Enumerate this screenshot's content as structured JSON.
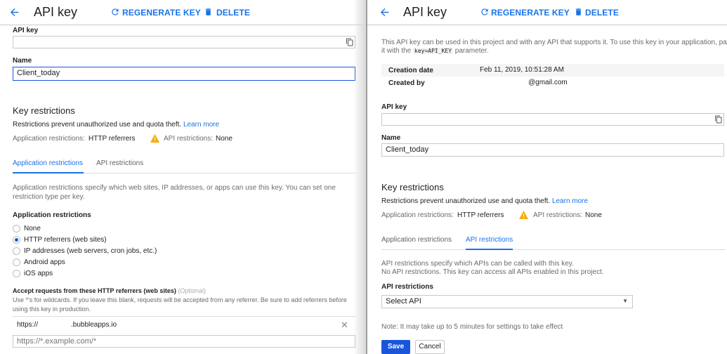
{
  "left": {
    "header": {
      "title": "API key",
      "regenerate": "REGENERATE KEY",
      "delete": "DELETE"
    },
    "api_key_label": "API key",
    "api_key_value": "",
    "name_label": "Name",
    "name_value": "Client_today",
    "key_restrictions": {
      "heading": "Key restrictions",
      "description": "Restrictions prevent unauthorized use and quota theft.",
      "learn_more": "Learn more",
      "app_label": "Application restrictions:",
      "app_value": "HTTP referrers",
      "api_label": "API restrictions:",
      "api_value": "None"
    },
    "tabs": [
      "Application restrictions",
      "API restrictions"
    ],
    "active_tab": 0,
    "app_desc_1": "Application restrictions specify which web sites, IP addresses, or apps can use this key. You can set one",
    "app_desc_2": "restriction type per key.",
    "app_restrictions_heading": "Application restrictions",
    "radio_options": [
      "None",
      "HTTP referrers (web sites)",
      "IP addresses (web servers, cron jobs, etc.)",
      "Android apps",
      "iOS apps"
    ],
    "selected_radio": 1,
    "accept_heading": "Accept requests from these HTTP referrers (web sites)",
    "optional": "(Optional)",
    "wildcard_1": "Use *'s for wildcards. If you leave this blank, requests will be accepted from any referrer. Be sure to add referrers before",
    "wildcard_2": "using this key in production.",
    "referrer_prefix": "https://",
    "referrer_suffix": ".bubbleapps.io",
    "referrer_placeholder": "https://*.example.com/*"
  },
  "right": {
    "header": {
      "title": "API key",
      "regenerate": "REGENERATE KEY",
      "delete": "DELETE"
    },
    "intro_1": "This API key can be used in this project and with any API that supports it. To use this key in your application, pass",
    "intro_2a": "it with the",
    "intro_code": "key=API_KEY",
    "intro_2b": "parameter.",
    "creation_label": "Creation date",
    "creation_value": "Feb 11, 2019, 10:51:28 AM",
    "created_by_label": "Created by",
    "created_by_value": "@gmail.com",
    "api_key_label": "API key",
    "api_key_value": "",
    "name_label": "Name",
    "name_value": "Client_today",
    "key_restrictions": {
      "heading": "Key restrictions",
      "description": "Restrictions prevent unauthorized use and quota theft.",
      "learn_more": "Learn more",
      "app_label": "Application restrictions:",
      "app_value": "HTTP referrers",
      "api_label": "API restrictions:",
      "api_value": "None"
    },
    "tabs": [
      "Application restrictions",
      "API restrictions"
    ],
    "active_tab": 1,
    "api_desc_1": "API restrictions specify which APIs can be called with this key.",
    "api_desc_2": "No API restrictions. This key can access all APIs enabled in this project.",
    "api_restrictions_heading": "API restrictions",
    "select_value": "Select API",
    "note": "Note: It may take up to 5 minutes for settings to take effect",
    "save": "Save",
    "cancel": "Cancel"
  },
  "colors": {
    "accent": "#1a73e8",
    "warning": "#f9ab00",
    "save_bg": "#1a56db"
  }
}
